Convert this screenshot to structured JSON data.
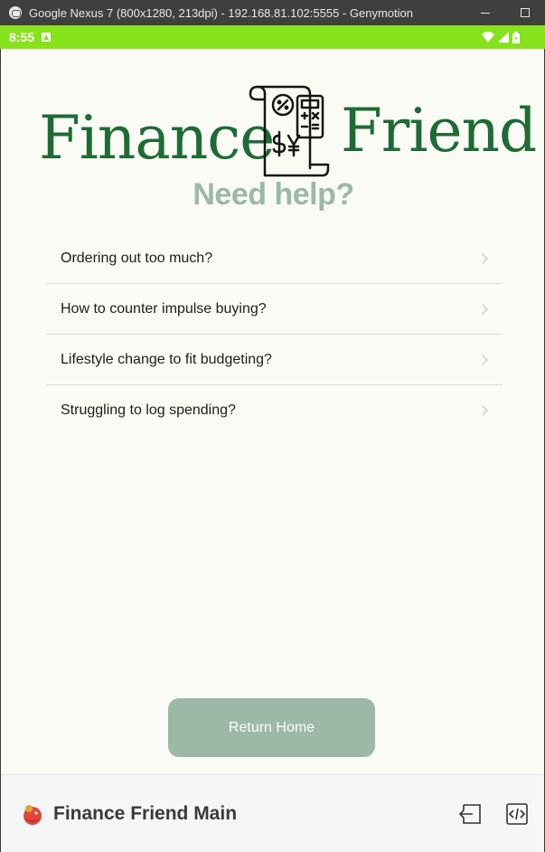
{
  "window": {
    "title": "Google Nexus 7 (800x1280, 213dpi) - 192.168.81.102:5555 - Genymotion"
  },
  "status_bar": {
    "time": "8:55",
    "accent_color": "#86e21a"
  },
  "app": {
    "logo_left": "Finance",
    "logo_right": "Friend",
    "heading": "Need help?",
    "heading_color": "#9cb8a7",
    "brand_color": "#1f6b35",
    "help_items": [
      {
        "label": "Ordering out too much?"
      },
      {
        "label": "How to counter impulse buying?"
      },
      {
        "label": "Lifestyle change to fit budgeting?"
      },
      {
        "label": "Struggling to log spending?"
      }
    ],
    "return_button": "Return Home"
  },
  "bottom_bar": {
    "title": "Finance Friend Main",
    "icons": [
      "app-icon",
      "exit-icon",
      "code-icon"
    ]
  }
}
